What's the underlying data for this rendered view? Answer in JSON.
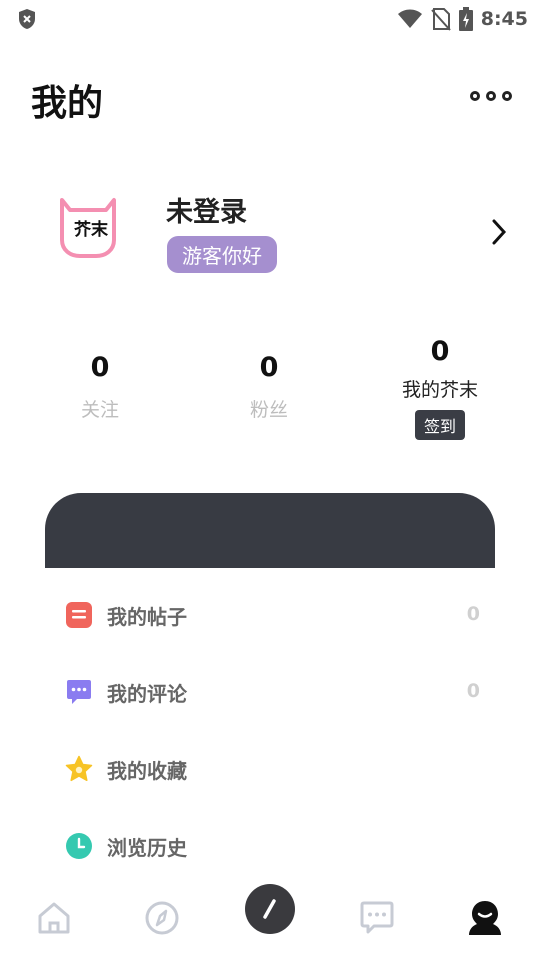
{
  "status_bar": {
    "time": "8:45",
    "icons": [
      "shield-icon",
      "wifi-icon",
      "no-sim-icon",
      "battery-charging-icon"
    ]
  },
  "header": {
    "title": "我的",
    "more_icon": "more-icon"
  },
  "profile": {
    "avatar_text": "芥末",
    "name": "未登录",
    "badge": "游客你好"
  },
  "stats": [
    {
      "value": "0",
      "label": "关注"
    },
    {
      "value": "0",
      "label": "粉丝"
    },
    {
      "value": "0",
      "label": "我的芥末",
      "action": "签到"
    }
  ],
  "menu": [
    {
      "label": "我的帖子",
      "count": "0",
      "icon": "posts-icon",
      "color": "#f0655c"
    },
    {
      "label": "我的评论",
      "count": "0",
      "icon": "comment-icon",
      "color": "#8a7cf0"
    },
    {
      "label": "我的收藏",
      "count": "",
      "icon": "star-icon",
      "color": "#f7c325"
    },
    {
      "label": "浏览历史",
      "count": "",
      "icon": "history-icon",
      "color": "#35c9b0"
    }
  ],
  "bottom_nav": [
    "home-icon",
    "discover-icon",
    "create-post-icon",
    "messages-icon",
    "profile-icon"
  ],
  "colors": {
    "badge": "#a58fcf",
    "dark_card": "#383b43",
    "accent_avatar": "#f48fb1"
  }
}
